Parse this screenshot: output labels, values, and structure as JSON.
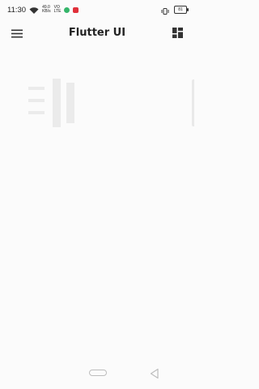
{
  "status": {
    "time": "11:30",
    "net_top": "49.0",
    "net_bottom": "KB/s",
    "vo": "VO",
    "vo2": "LTE",
    "battery": "81"
  },
  "app": {
    "title": "Flutter UI",
    "menu_icon": "hamburger-menu-icon",
    "dashboard_icon": "dashboard-icon"
  },
  "nav": {
    "home_icon": "home-pill-icon",
    "back_icon": "back-triangle-icon"
  },
  "colors": {
    "background": "#fbfbfb",
    "text": "#222222",
    "accent_green": "#35b56a",
    "accent_red": "#e0303a"
  }
}
